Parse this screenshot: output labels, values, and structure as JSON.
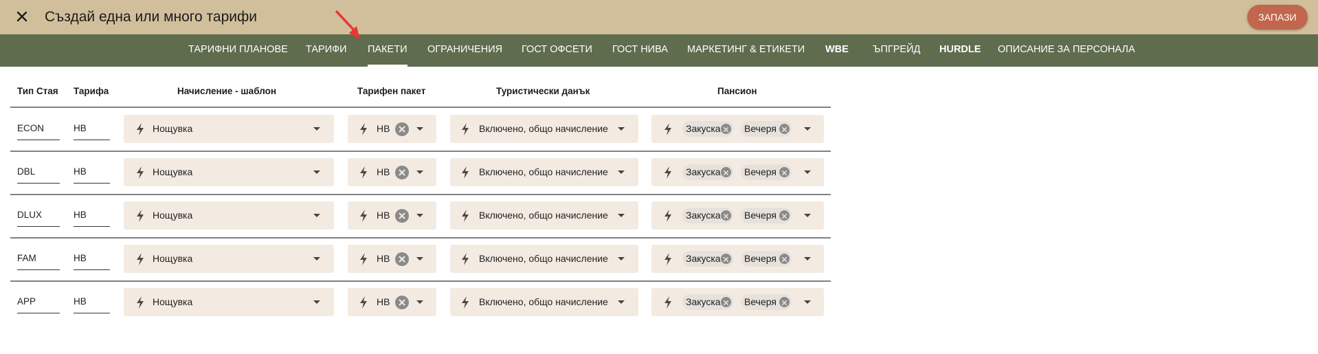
{
  "header": {
    "title": "Създай една или много тарифи",
    "save_label": "ЗАПАЗИ"
  },
  "tabs": [
    {
      "label": "ТАРИФНИ ПЛАНОВЕ",
      "active": false
    },
    {
      "label": "ТАРИФИ",
      "active": false
    },
    {
      "label": "ПАКЕТИ",
      "active": true
    },
    {
      "label": "ОГРАНИЧЕНИЯ",
      "active": false
    },
    {
      "label": "ГОСТ ОФСЕТИ",
      "active": false
    },
    {
      "label": "ГОСТ НИВА",
      "active": false
    },
    {
      "label": "МАРКЕТИНГ & ЕТИКЕТИ",
      "active": false
    },
    {
      "label": "WBE",
      "active": false
    },
    {
      "label": "ЪПГРЕЙД",
      "active": false
    },
    {
      "label": "HURDLE",
      "active": false
    },
    {
      "label": "ОПИСАНИЕ ЗА ПЕРСОНАЛА",
      "active": false
    }
  ],
  "table": {
    "columns": [
      "Тип Стая",
      "Тарифа",
      "Начисление - шаблон",
      "Тарифен пакет",
      "Туристически данък",
      "Пансион"
    ],
    "rows": [
      {
        "room_type": "ECON",
        "rate": "НВ",
        "charge_template": "Нощувка",
        "package": "НВ",
        "tourist_tax": "Включено, общо начисление",
        "board": [
          "Закуска",
          "Вечеря"
        ]
      },
      {
        "room_type": "DBL",
        "rate": "НВ",
        "charge_template": "Нощувка",
        "package": "НВ",
        "tourist_tax": "Включено, общо начисление",
        "board": [
          "Закуска",
          "Вечеря"
        ]
      },
      {
        "room_type": "DLUX",
        "rate": "НВ",
        "charge_template": "Нощувка",
        "package": "НВ",
        "tourist_tax": "Включено, общо начисление",
        "board": [
          "Закуска",
          "Вечеря"
        ]
      },
      {
        "room_type": "FAM",
        "rate": "НВ",
        "charge_template": "Нощувка",
        "package": "НВ",
        "tourist_tax": "Включено, общо начисление",
        "board": [
          "Закуска",
          "Вечеря"
        ]
      },
      {
        "room_type": "APP",
        "rate": "НВ",
        "charge_template": "Нощувка",
        "package": "НВ",
        "tourist_tax": "Включено, общо начисление",
        "board": [
          "Закуска",
          "Вечеря"
        ]
      }
    ]
  },
  "icons": {
    "close": "close-icon",
    "bolt": "bolt-icon",
    "dropdown": "chevron-down-icon",
    "clear": "clear-circle-icon",
    "annotation": "red-arrow-icon"
  },
  "colors": {
    "header_bg": "#d1bf9b",
    "tabbar_bg": "#5f6c4e",
    "save_button": "#c2664e",
    "field_bg": "#f3ebe2",
    "chip_bg": "#e6e1da",
    "annotation_arrow": "#e53935"
  }
}
